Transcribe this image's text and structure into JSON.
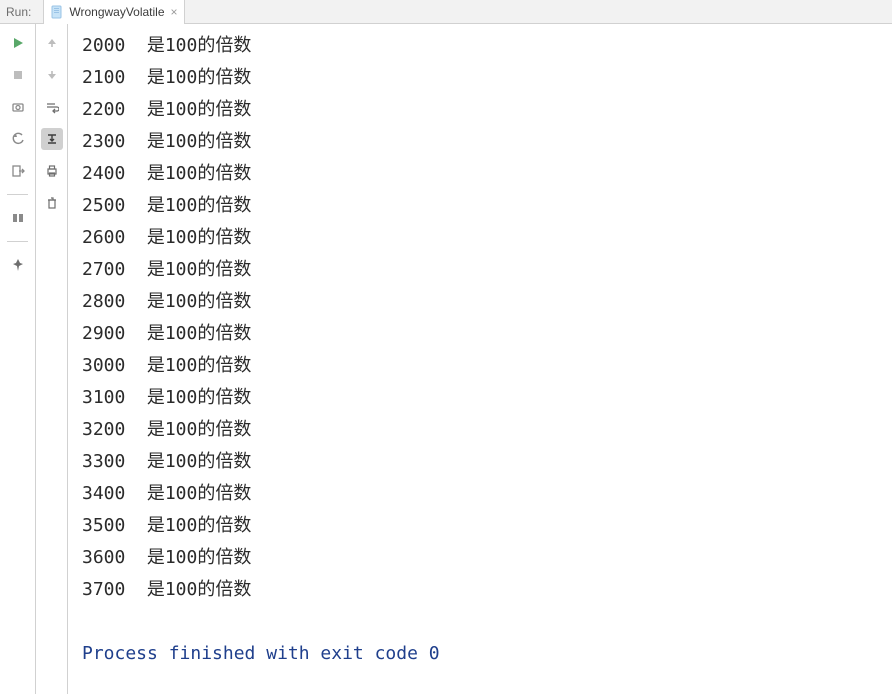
{
  "header": {
    "run_label": "Run:",
    "tab_label": "WrongwayVolatile",
    "close_glyph": "×"
  },
  "gutter_left": {
    "run": "run-icon",
    "stop": "stop-icon",
    "camera": "camera-icon",
    "rerun": "rerun-icon",
    "exit": "exit-icon",
    "layout": "layout-icon",
    "pin": "pin-icon"
  },
  "gutter_right": {
    "up": "up-arrow-icon",
    "down": "down-arrow-icon",
    "wrap": "soft-wrap-icon",
    "scroll": "scroll-to-end-icon",
    "print": "print-icon",
    "trash": "trash-icon"
  },
  "console": {
    "suffix": " 是100的倍数",
    "values": [
      2000,
      2100,
      2200,
      2300,
      2400,
      2500,
      2600,
      2700,
      2800,
      2900,
      3000,
      3100,
      3200,
      3300,
      3400,
      3500,
      3600,
      3700
    ],
    "exit_line": "Process finished with exit code 0"
  }
}
